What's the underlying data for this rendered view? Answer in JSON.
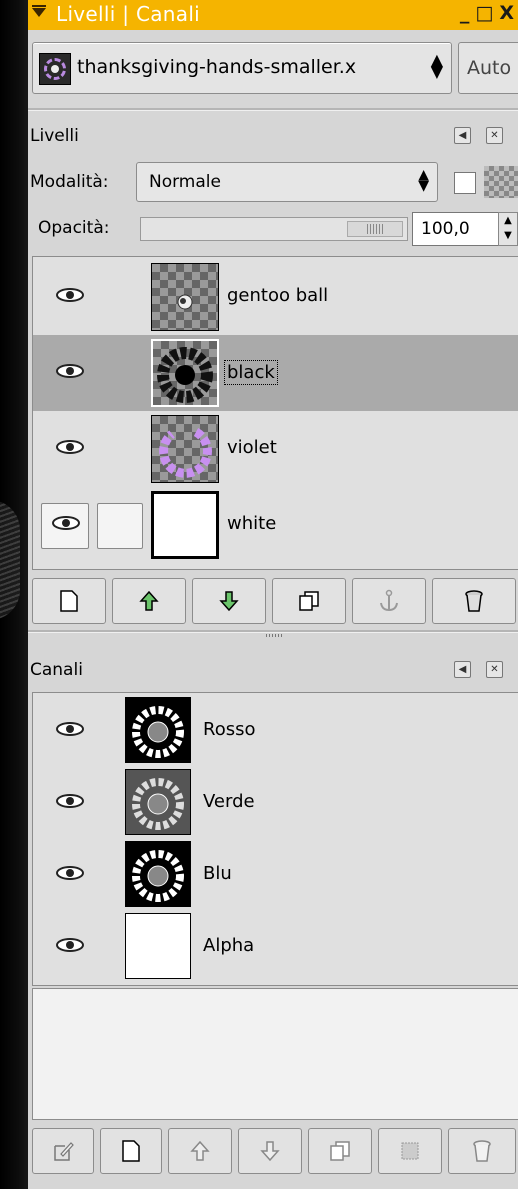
{
  "window": {
    "title": "Livelli | Canali",
    "buttons": [
      "_",
      "□",
      "X"
    ]
  },
  "image_selector": {
    "value": "thanksgiving-hands-smaller.x",
    "auto_label": "Auto"
  },
  "layers_panel": {
    "title": "Livelli",
    "mode_label": "Modalità:",
    "mode_value": "Normale",
    "opacity_label": "Opacità:",
    "opacity_value": "100,0",
    "opacity_fraction": 1.0,
    "layers": [
      {
        "name": "gentoo ball",
        "visible": true,
        "selected": false
      },
      {
        "name": "black",
        "visible": true,
        "selected": true
      },
      {
        "name": "violet",
        "visible": true,
        "selected": false
      },
      {
        "name": "white",
        "visible": true,
        "selected": false
      }
    ],
    "toolbar": [
      "new-layer-icon",
      "raise-layer-icon",
      "lower-layer-icon",
      "duplicate-layer-icon",
      "anchor-layer-icon",
      "delete-layer-icon"
    ]
  },
  "channels_panel": {
    "title": "Canali",
    "channels": [
      {
        "name": "Rosso",
        "visible": true
      },
      {
        "name": "Verde",
        "visible": true
      },
      {
        "name": "Blu",
        "visible": true
      },
      {
        "name": "Alpha",
        "visible": true
      }
    ],
    "toolbar": [
      "edit-channel-icon",
      "new-channel-icon",
      "raise-channel-icon",
      "lower-channel-icon",
      "duplicate-channel-icon",
      "channel-to-selection-icon",
      "delete-channel-icon"
    ]
  },
  "colors": {
    "titlebar": "#f5b400",
    "selected_row": "#aaaaaa",
    "panel_bg": "#d6d6d6",
    "violet": "#c890f0"
  }
}
